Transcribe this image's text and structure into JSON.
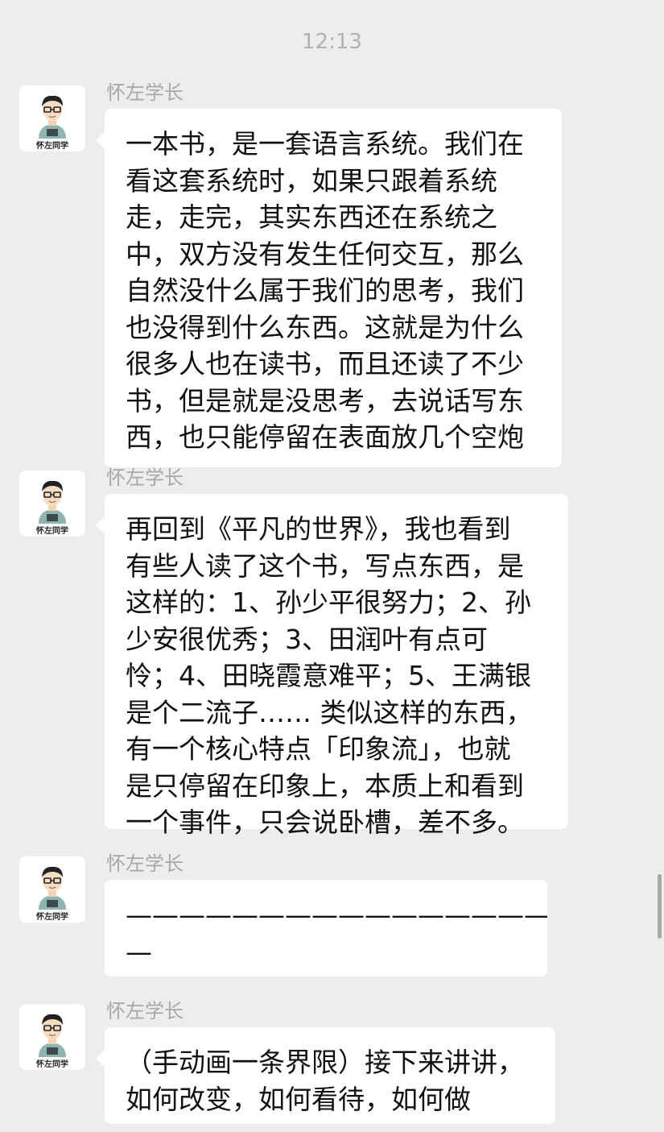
{
  "chat": {
    "time": "12:13",
    "messages": [
      {
        "sender": "怀左学长",
        "avatar_caption": "怀左同学",
        "text": "一本书，是一套语言系统。我们在\n看这套系统时，如果只跟着系统\n走，走完，其实东西还在系统之\n中，双方没有发生任何交互，那么\n自然没什么属于我们的思考，我们\n也没得到什么东西。这就是为什么\n很多人也在读书，而且还读了不少\n书，但是就是没思考，去说话写东\n西，也只能停留在表面放几个空炮"
      },
      {
        "sender": "怀左学长",
        "avatar_caption": "怀左同学",
        "text": "再回到《平凡的世界》，我也看到\n有些人读了这个书，写点东西，是\n这样的：1、孙少平很努力；2、孙\n少安很优秀；3、田润叶有点可\n怜；4、田晓霞意难平；5、王满银\n是个二流子…… 类似这样的东西，\n有一个核心特点「印象流」，也就\n是只停留在印象上，本质上和看到\n一个事件，只会说卧槽，差不多。"
      },
      {
        "sender": "怀左学长",
        "avatar_caption": "怀左同学",
        "text": "——————————————————\n—"
      },
      {
        "sender": "怀左学长",
        "avatar_caption": "怀左同学",
        "text": "（手动画一条界限）接下来讲讲，\n如何改变，如何看待，如何做"
      }
    ]
  },
  "colors": {
    "background": "#ededed",
    "bubble": "#ffffff",
    "text": "#111111",
    "meta_text": "#a8a8a8",
    "avatar_shirt": "#8fb5b0"
  },
  "icons": {
    "avatar": "cartoon-boy-with-glasses-avatar",
    "scrollbar": "scroll-thumb"
  }
}
